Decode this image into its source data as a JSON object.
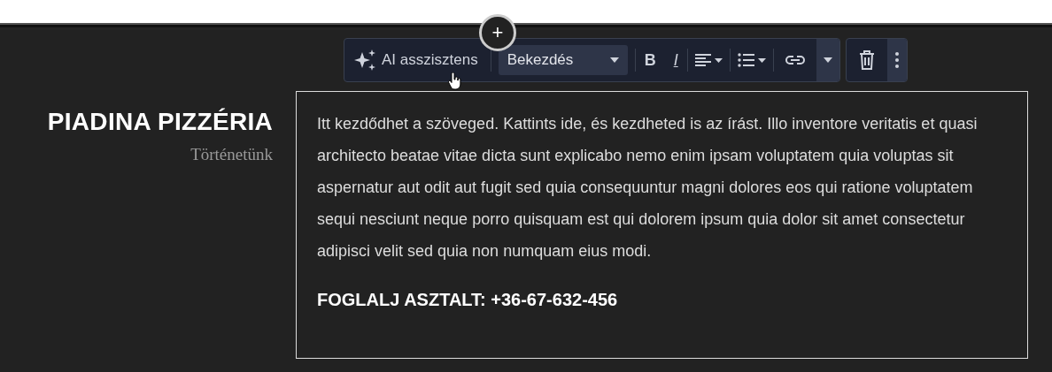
{
  "add_button": {
    "label": "+"
  },
  "toolbar": {
    "ai_button": "AI asszisztens",
    "block_format": "Bekezdés",
    "bold": "B",
    "italic": "I"
  },
  "heading": "PIADINA PIZZÉRIA",
  "subheading": "Történetünk",
  "body": "Itt kezdődhet a szöveged. Kattints ide, és kezdheted is az írást. Illo inventore veritatis et quasi architecto beatae vitae dicta sunt explicabo nemo enim ipsam voluptatem quia voluptas sit aspernatur aut odit aut fugit sed quia consequuntur magni dolores eos qui ratione voluptatem sequi nesciunt neque porro quisquam est qui dolorem ipsum quia dolor sit amet consectetur adipisci velit sed quia non numquam eius modi.",
  "cta": "FOGLALJ ASZTALT: +36-67-632-456"
}
